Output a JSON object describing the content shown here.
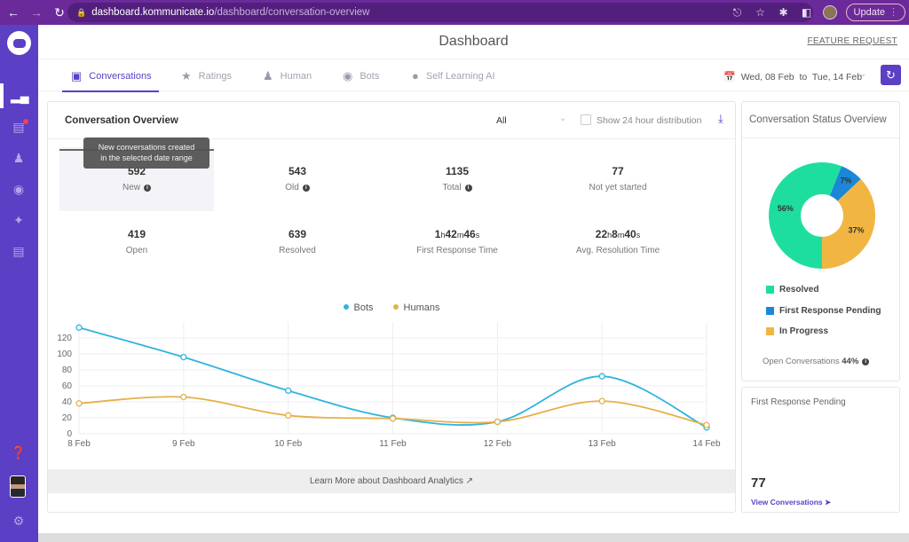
{
  "browser": {
    "url_host": "dashboard.kommunicate.io",
    "url_path": "/dashboard/conversation-overview",
    "update_label": "Update",
    "icons": [
      "back-icon",
      "forward-icon",
      "reload-icon",
      "lock-icon",
      "share-icon",
      "star-icon",
      "extensions-icon",
      "sidebar-icon",
      "profile-icon"
    ]
  },
  "sidebar": {
    "items": [
      {
        "name": "dashboard",
        "icon": "bar-chart-icon",
        "active": true
      },
      {
        "name": "conversations",
        "icon": "chat-icon",
        "badge": true
      },
      {
        "name": "users",
        "icon": "users-icon"
      },
      {
        "name": "bots",
        "icon": "bot-icon"
      },
      {
        "name": "integrations",
        "icon": "integrations-icon"
      },
      {
        "name": "reports",
        "icon": "document-icon"
      }
    ],
    "bottom": [
      "help-icon",
      "avatar",
      "settings-icon"
    ]
  },
  "header": {
    "title": "Dashboard",
    "feature_request": "FEATURE REQUEST"
  },
  "tabs": [
    {
      "label": "Conversations",
      "icon": "chat-icon",
      "active": true
    },
    {
      "label": "Ratings",
      "icon": "star-icon"
    },
    {
      "label": "Human",
      "icon": "person-icon"
    },
    {
      "label": "Bots",
      "icon": "bot-icon"
    },
    {
      "label": "Self Learning AI",
      "icon": "bulb-icon"
    }
  ],
  "date_range": "Wed, 08 Feb  to  Tue, 14 Feb",
  "overview": {
    "title": "Conversation Overview",
    "filter_value": "All",
    "checkbox_label": "Show 24 hour distribution",
    "checkbox_checked": false,
    "tooltip": [
      "New conversations created",
      "in the selected date range"
    ],
    "stats": [
      {
        "value": "592",
        "label": "New",
        "info": true
      },
      {
        "value": "543",
        "label": "Old",
        "info": true
      },
      {
        "value": "1135",
        "label": "Total",
        "info": true
      },
      {
        "value": "77",
        "label": "Not yet started"
      },
      {
        "value": "419",
        "label": "Open"
      },
      {
        "value": "639",
        "label": "Resolved"
      },
      {
        "value_parts": [
          [
            "1",
            "h"
          ],
          [
            "42",
            "m"
          ],
          [
            "46",
            "s"
          ]
        ],
        "label": "First Response Time"
      },
      {
        "value_parts": [
          [
            "22",
            "h"
          ],
          [
            "8",
            "m"
          ],
          [
            "40",
            "s"
          ]
        ],
        "label": "Avg. Resolution Time"
      }
    ],
    "learn_more": "Learn More about Dashboard Analytics"
  },
  "chart_data": [
    {
      "type": "line",
      "title": "",
      "xlabel": "",
      "ylabel": "",
      "categories": [
        "8 Feb",
        "9 Feb",
        "10 Feb",
        "11 Feb",
        "12 Feb",
        "13 Feb",
        "14 Feb"
      ],
      "ylim": [
        0,
        140
      ],
      "yticks": [
        0,
        20,
        40,
        60,
        80,
        100,
        120
      ],
      "grid": true,
      "legend": "top-center",
      "series": [
        {
          "name": "Bots",
          "color": "#2fb4de",
          "values": [
            133,
            96,
            54,
            20,
            15,
            72,
            8
          ]
        },
        {
          "name": "Humans",
          "color": "#e6b04a",
          "values": [
            38,
            46,
            23,
            19,
            15,
            41,
            11
          ]
        }
      ]
    },
    {
      "type": "pie",
      "title": "Conversation Status Overview",
      "donut": true,
      "labels": [
        "Resolved",
        "First Response Pending",
        "In Progress"
      ],
      "values": [
        56,
        7,
        37
      ],
      "data_labels": [
        "56%",
        "7%",
        "37%"
      ],
      "colors": [
        "#1ede9f",
        "#1b87d6",
        "#f1b642"
      ],
      "legend": "bottom"
    }
  ],
  "status_card": {
    "title": "Conversation Status Overview",
    "open_label": "Open Conversations",
    "open_value": "44%"
  },
  "frp_card": {
    "title": "First Response Pending",
    "value": "77",
    "link": "View Conversations"
  }
}
